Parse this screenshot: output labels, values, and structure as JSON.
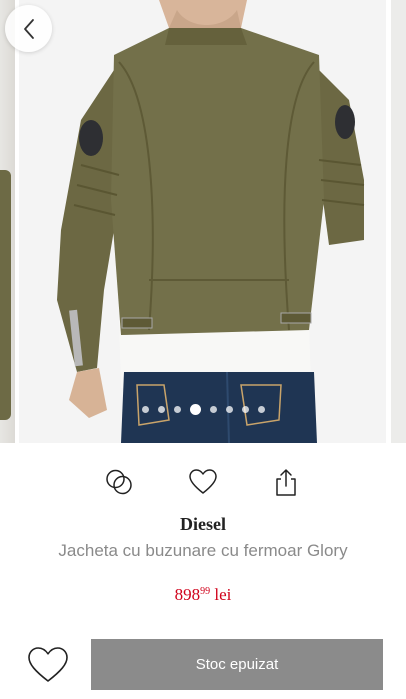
{
  "gallery": {
    "dot_count": 8,
    "active_dot_index": 3
  },
  "product": {
    "brand": "Diesel",
    "name": "Jacheta cu buzunare cu fermoar Glory",
    "price_integer": "898",
    "price_decimals": "99",
    "currency": "lei"
  },
  "actions": {
    "compare_icon": "compare-icon",
    "wishlist_icon": "heart-icon",
    "share_icon": "share-icon"
  },
  "bottom": {
    "stock_label": "Stoc epuizat"
  },
  "colors": {
    "price": "#d0021b",
    "stock_button_bg": "#8b8b8b",
    "jacket": "#6f6b45"
  }
}
